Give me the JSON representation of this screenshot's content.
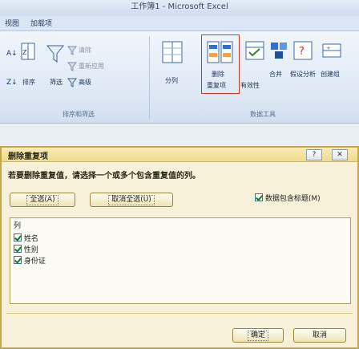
{
  "window": {
    "title": "工作簿1 - Microsoft Excel"
  },
  "tabs": [
    "视图",
    "加载项"
  ],
  "ribbon": {
    "sort_label": "排序",
    "filter_label": "筛选",
    "advanced_label": "高级",
    "sort_filter_group": "排序和筛选",
    "split_label": "分列",
    "remove_dup_label": "删除",
    "remove_dup_label2": "重复项",
    "validation_label": "有效性",
    "consolidate_label": "合并",
    "whatif_label": "假设分析",
    "group_label": "创建组",
    "data_tools_group": "数据工具",
    "clear_label": "清除",
    "reapply_label": "重新应用"
  },
  "dialog": {
    "title": "删除重复项",
    "help_label": "?",
    "close_label": "✕",
    "instruction": "若要删除重复值，请选择一个或多个包含重复值的列。",
    "select_all_label": "全选(A)",
    "unselect_all_label": "取消全选(U)",
    "header_check_label": "数据包含标题(M)",
    "list_header": "列",
    "columns": [
      "姓名",
      "性别",
      "身份证"
    ],
    "ok_label": "确定",
    "cancel_label": "取消"
  }
}
